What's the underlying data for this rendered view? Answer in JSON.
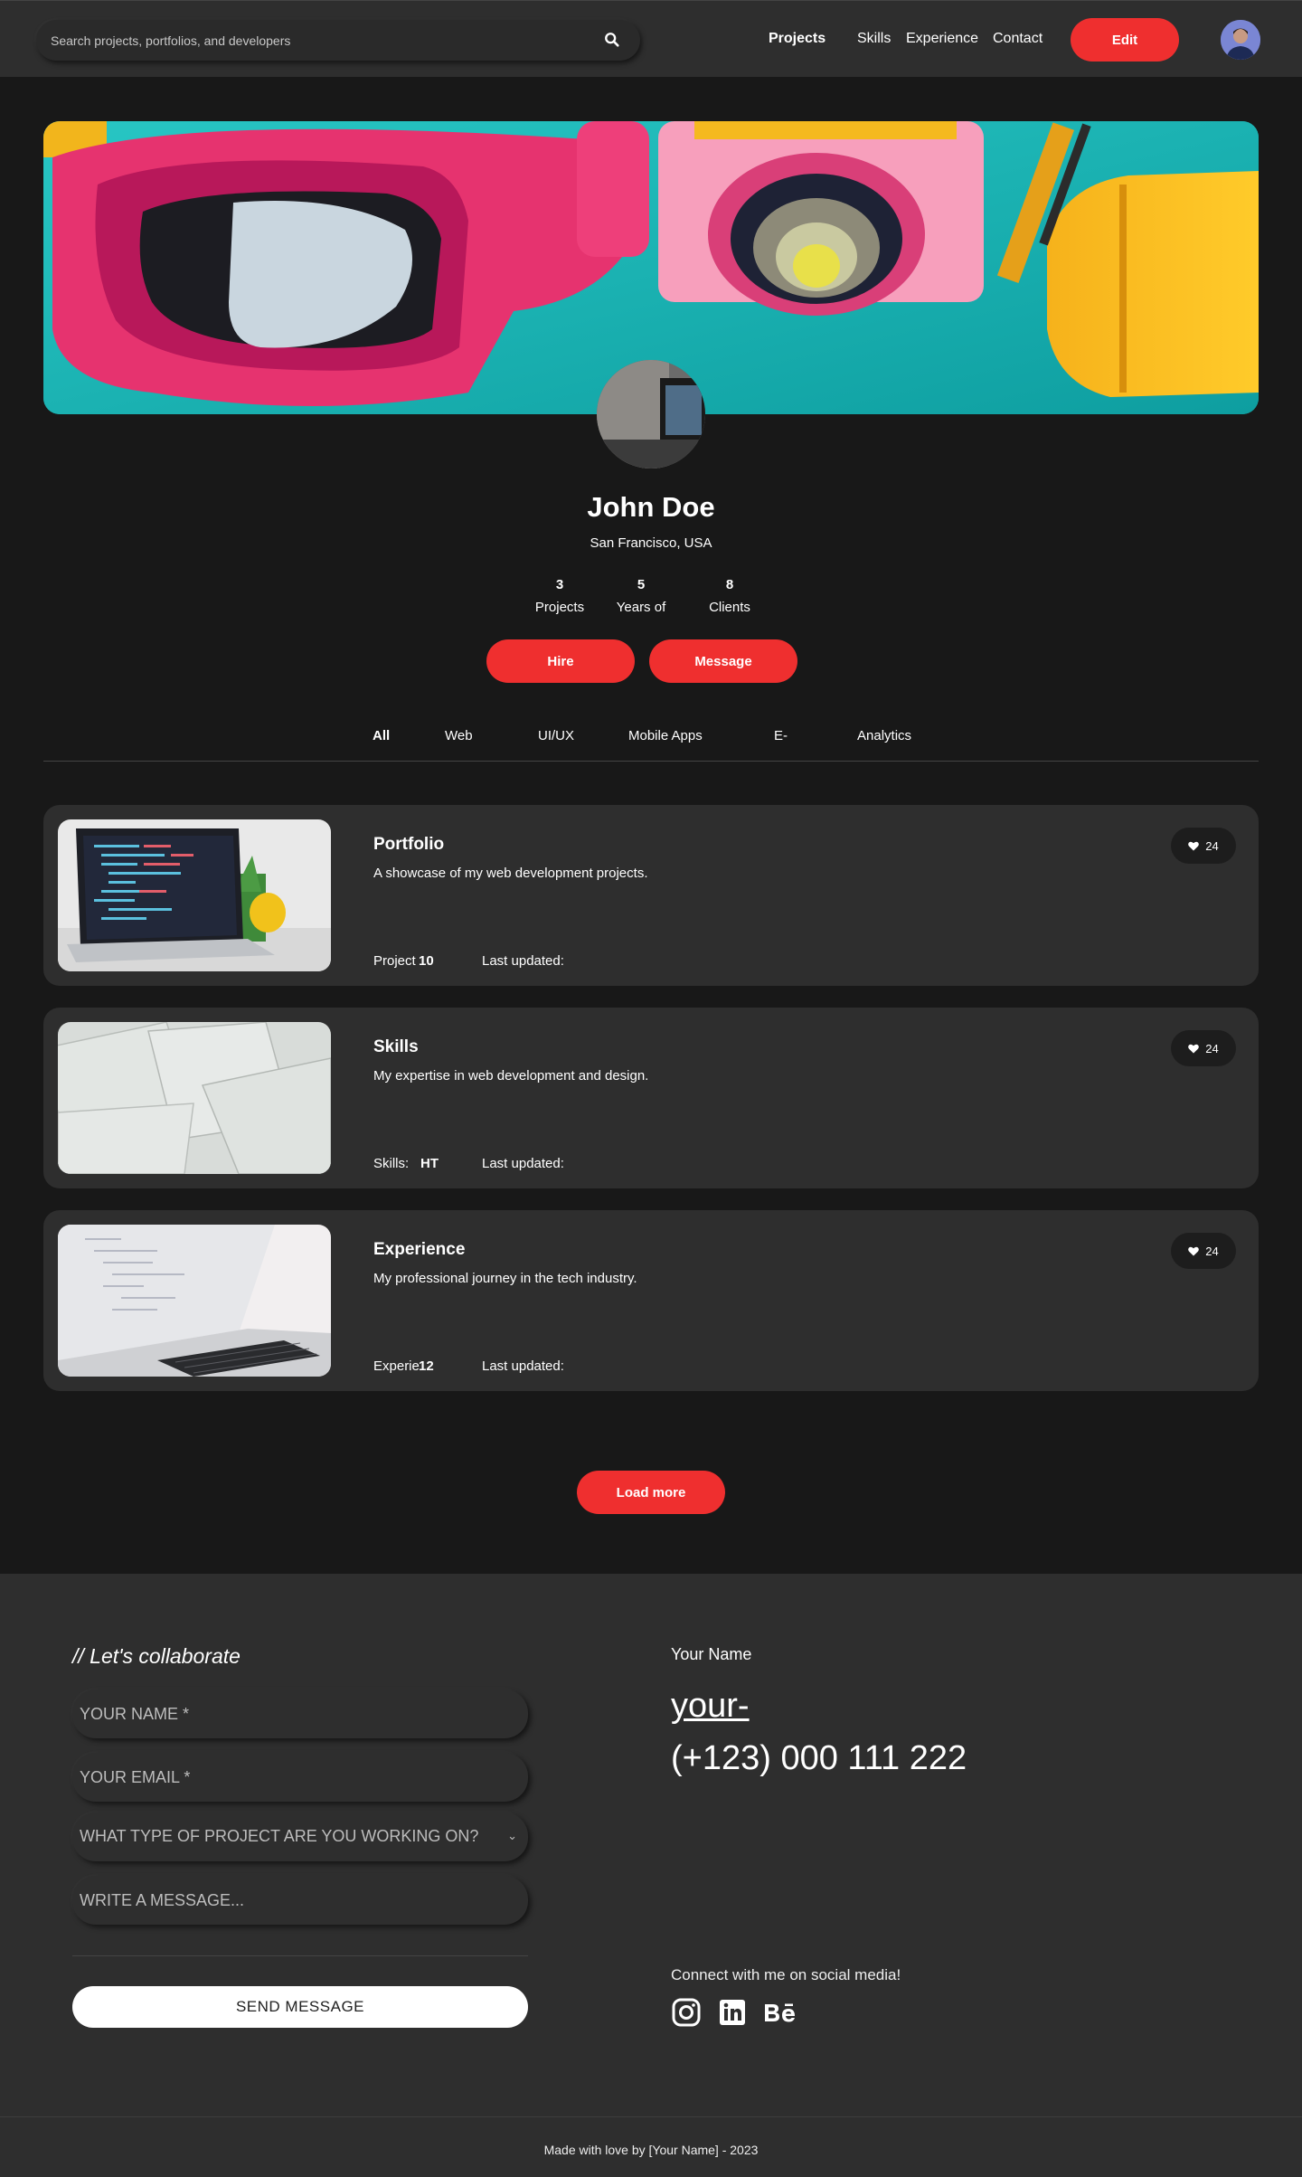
{
  "nav": {
    "search_placeholder": "Search projects, portfolios, and developers",
    "links": [
      {
        "label": "Projects"
      },
      {
        "label": "Skills"
      },
      {
        "label": "Experience"
      },
      {
        "label": "Contact"
      }
    ],
    "edit_label": "Edit"
  },
  "profile": {
    "name": "John Doe",
    "location": "San Francisco, USA",
    "stats": [
      {
        "value": "3",
        "label": "Projects"
      },
      {
        "value": "5",
        "label": "Years of"
      },
      {
        "value": "8",
        "label": "Clients"
      }
    ],
    "hire_label": "Hire",
    "message_label": "Message"
  },
  "tabs": [
    {
      "label": "All"
    },
    {
      "label": "Web"
    },
    {
      "label": "UI/UX"
    },
    {
      "label": "Mobile Apps"
    },
    {
      "label": "E-"
    },
    {
      "label": "Analytics"
    }
  ],
  "cards": [
    {
      "title": "Portfolio",
      "description": "A showcase of my web development projects.",
      "meta_label": "Project",
      "meta_value": "10",
      "updated_label": "Last updated:",
      "likes": "24"
    },
    {
      "title": "Skills",
      "description": "My expertise in web development and design.",
      "meta_label": "Skills:",
      "meta_value": "HT",
      "updated_label": "Last updated:",
      "likes": "24"
    },
    {
      "title": "Experience",
      "description": "My professional journey in the tech industry.",
      "meta_label": "Experie",
      "meta_value": "12",
      "updated_label": "Last updated:",
      "likes": "24"
    }
  ],
  "load_more_label": "Load more",
  "contact": {
    "heading": "// Let's collaborate",
    "name_placeholder": "YOUR NAME *",
    "email_placeholder": "YOUR EMAIL *",
    "project_type_placeholder": "WHAT TYPE OF PROJECT ARE YOU WORKING ON?",
    "message_placeholder": "WRITE A MESSAGE...",
    "send_label": "SEND MESSAGE",
    "your_name": "Your Name",
    "email_text": "your-",
    "phone": "(+123) 000 111 222",
    "connect_text": "Connect with me on social media!",
    "social_icons": [
      "instagram-icon",
      "linkedin-icon",
      "behance-icon"
    ]
  },
  "footer": {
    "text": "Made with love by [Your Name] - 2023"
  },
  "colors": {
    "accent": "#ef2f2f",
    "background": "#181818",
    "surface": "#2e2e2e"
  }
}
